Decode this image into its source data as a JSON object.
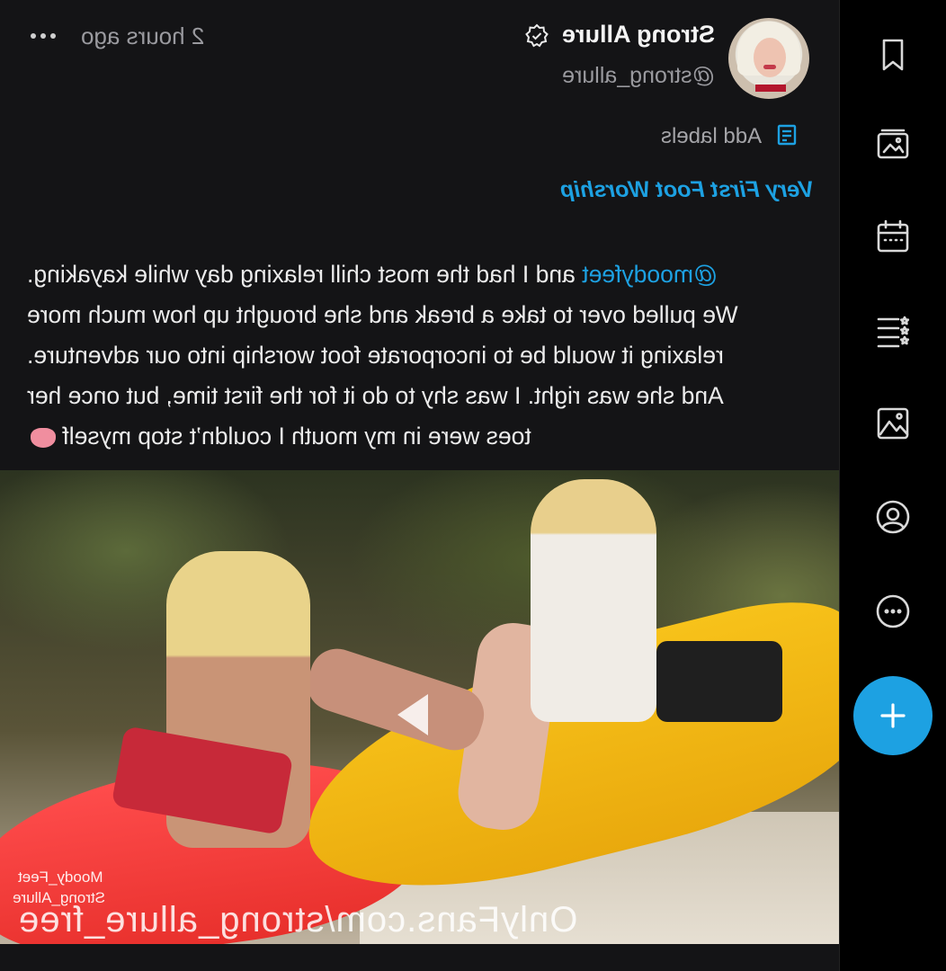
{
  "post": {
    "timestamp": "2 hours ago",
    "author_name": "Strong Allure",
    "author_handle": "@strong_allure",
    "add_labels": "Add labels",
    "title": "Very First Foot Worship",
    "body_lines": [
      {
        "mention": "@moodyfeet",
        "text": " and I had the most chill relaxing day while kayaking."
      },
      {
        "text": "We pulled over to take a break and she brought up how much more"
      },
      {
        "text": "relaxing it would be to incorporate foot worship into our adventure."
      },
      {
        "text": "And she was right. I was shy to do it for the first time, but once her"
      },
      {
        "text": "toes were in my mouth I couldn’t stop myself"
      }
    ],
    "media": {
      "watermark": "OnlyFans.com/strong_allure_free",
      "tag1": "Moody_Feet",
      "tag2": "Strong_Allure"
    }
  },
  "rail": {
    "items": [
      "bookmark-icon",
      "vault-icon",
      "calendar-icon",
      "lists-icon",
      "media-icon",
      "profile-icon",
      "more-icon"
    ],
    "fab": "plus-icon"
  },
  "colors": {
    "accent": "#1da1e2",
    "background": "#141416",
    "rail": "#000000"
  }
}
